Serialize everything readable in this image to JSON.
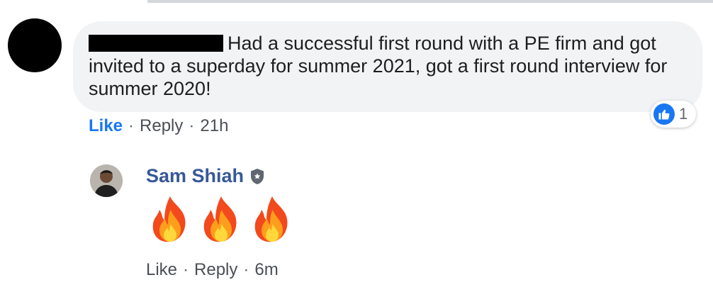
{
  "comment": {
    "text": "Had a successful first round with a PE firm and got invited to a superday for summer 2021, got a first round interview for summer 2020!",
    "reaction_count": "1",
    "reaction_icon": "like-reaction-icon",
    "actions": {
      "like": "Like",
      "separator": "·",
      "reply": "Reply",
      "time": "21h"
    }
  },
  "reply": {
    "author": "Sam Shiah",
    "badge_icon": "shield-icon",
    "emojis": [
      "fire",
      "fire",
      "fire"
    ],
    "actions": {
      "like": "Like",
      "separator": "·",
      "reply": "Reply",
      "time": "6m"
    }
  },
  "colors": {
    "link_blue": "#1877f2",
    "name_blue": "#385898",
    "bubble_bg": "#f2f3f5",
    "meta_gray": "#4b4f56"
  }
}
